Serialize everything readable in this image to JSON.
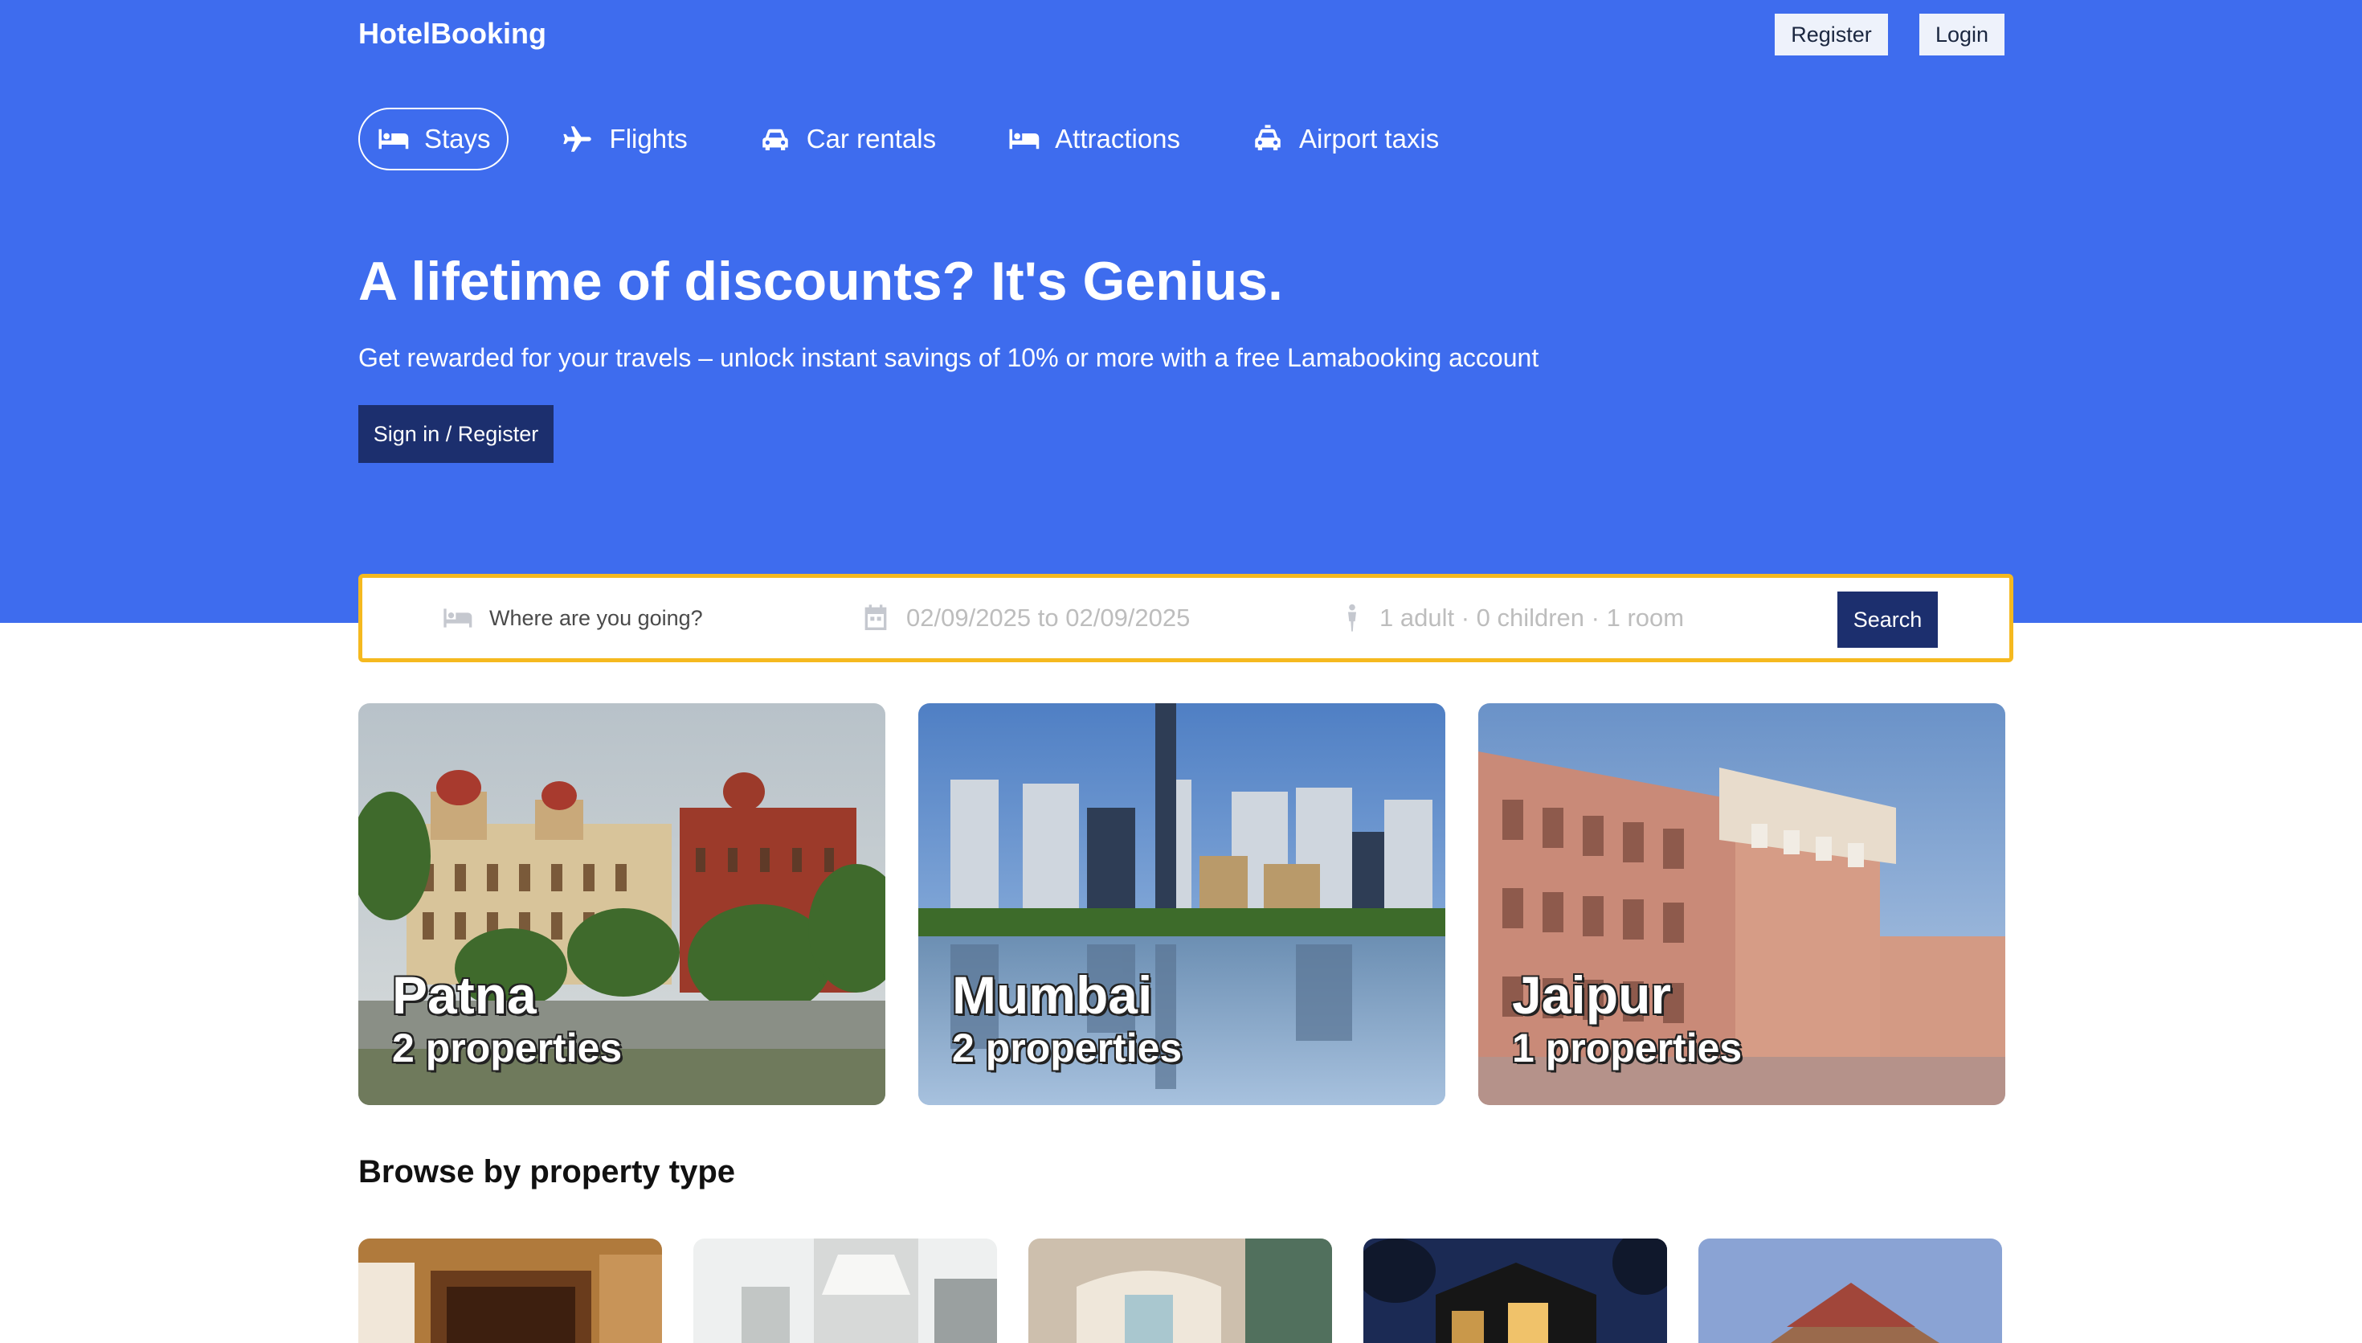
{
  "brand": "HotelBooking",
  "header": {
    "register_label": "Register",
    "login_label": "Login"
  },
  "nav": {
    "tabs": [
      {
        "label": "Stays",
        "icon": "bed-icon",
        "active": true
      },
      {
        "label": "Flights",
        "icon": "plane-icon",
        "active": false
      },
      {
        "label": "Car rentals",
        "icon": "car-icon",
        "active": false
      },
      {
        "label": "Attractions",
        "icon": "bed-icon",
        "active": false
      },
      {
        "label": "Airport taxis",
        "icon": "taxi-icon",
        "active": false
      }
    ]
  },
  "hero": {
    "title": "A lifetime of discounts? It's Genius.",
    "subtitle": "Get rewarded for your travels – unlock instant savings of 10% or more with a free Lamabooking account",
    "cta_label": "Sign in / Register"
  },
  "search": {
    "destination_placeholder": "Where are you going?",
    "dates": "02/09/2025 to 02/09/2025",
    "guests": "1 adult · 0 children · 1 room",
    "button_label": "Search"
  },
  "featured": [
    {
      "city": "Patna",
      "count": "2 properties"
    },
    {
      "city": "Mumbai",
      "count": "2 properties"
    },
    {
      "city": "Jaipur",
      "count": "1 properties"
    }
  ],
  "property_types": {
    "title": "Browse by property type",
    "items": [
      "hotel-image",
      "apartment-image",
      "resort-image",
      "villa-image",
      "cabin-image"
    ]
  },
  "colors": {
    "hero_bg": "#3e6cee",
    "dark_button": "#1c2f6e",
    "search_border": "#f5b91f"
  }
}
